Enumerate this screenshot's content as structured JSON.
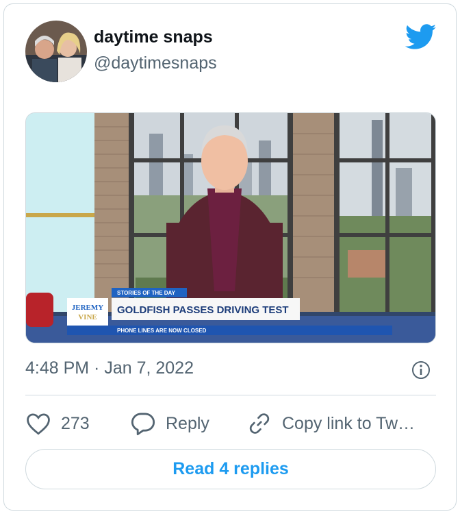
{
  "tweet": {
    "author_name": "daytime snaps",
    "author_handle": "@daytimesnaps",
    "timestamp": "4:48 PM · Jan 7, 2022"
  },
  "media": {
    "show_logo_top": "JEREMY",
    "show_logo_bottom": "VINE",
    "strap_label": "STORIES OF THE DAY",
    "headline": "GOLDFISH PASSES DRIVING TEST",
    "ticker": "PHONE LINES ARE NOW CLOSED"
  },
  "actions": {
    "like_count": "273",
    "reply_label": "Reply",
    "copy_link_label": "Copy link to Tw…"
  },
  "read_replies_label": "Read 4 replies",
  "colors": {
    "twitter_blue": "#1d9bf0",
    "secondary_text": "#536471",
    "border": "#cfd9de"
  },
  "icons": [
    "twitter-bird-icon",
    "info-icon",
    "heart-icon",
    "reply-icon",
    "link-icon"
  ]
}
